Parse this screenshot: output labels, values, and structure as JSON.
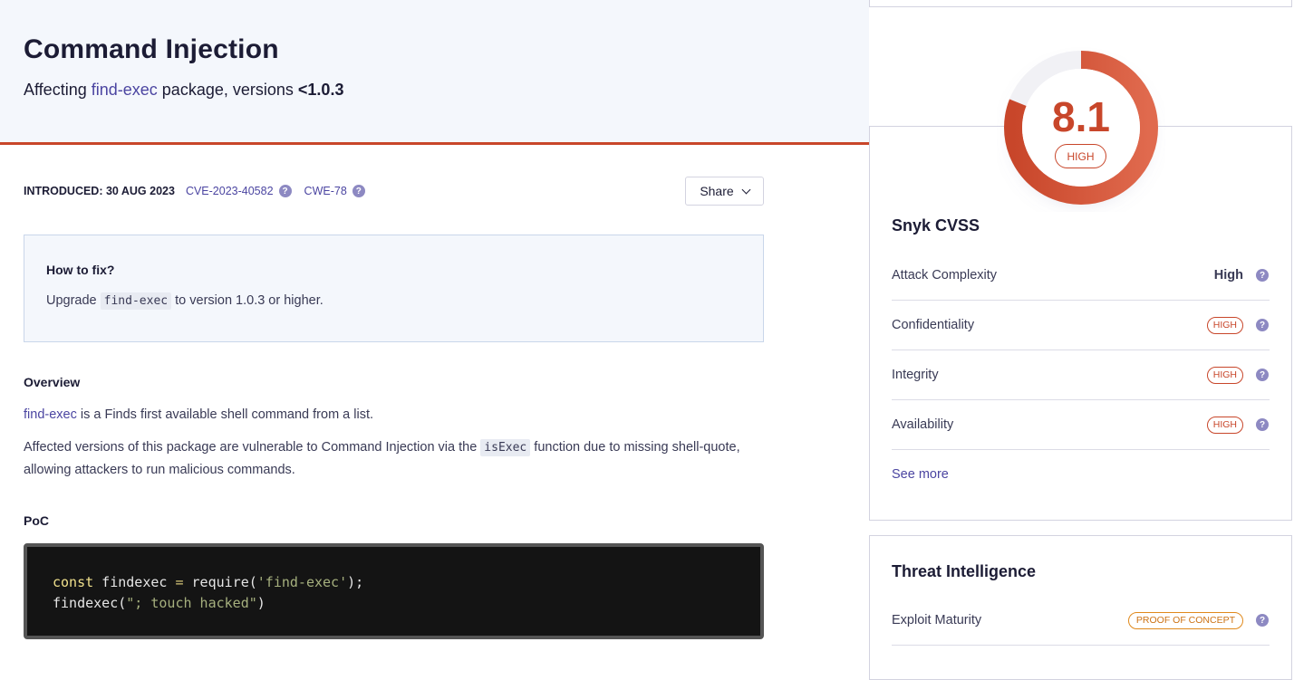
{
  "title": "Command Injection",
  "affect": {
    "prefix": "Affecting",
    "package": "find-exec",
    "middle": "package, versions",
    "versions": "<1.0.3"
  },
  "meta": {
    "introduced": "INTRODUCED: 30 AUG 2023",
    "cve": "CVE-2023-40582",
    "cwe": "CWE-78"
  },
  "share_label": "Share",
  "fix": {
    "heading": "How to fix?",
    "pre": "Upgrade",
    "code": "find-exec",
    "post": "to version 1.0.3 or higher."
  },
  "overview": {
    "heading": "Overview",
    "p1_link": "find-exec",
    "p1_rest": " is a Finds first available shell command from a list.",
    "p2_pre": "Affected versions of this package are vulnerable to Command Injection via the ",
    "p2_code": "isExec",
    "p2_post": " function due to missing shell-quote, allowing attackers to run malicious commands."
  },
  "poc": {
    "heading": "PoC",
    "line1": {
      "kw": "const",
      "name": " findexec ",
      "op": "=",
      "call": " require(",
      "str": "'find-exec'",
      "end": ");"
    },
    "line2": {
      "call": "findexec(",
      "str": "\"; touch hacked\"",
      "end": ")"
    }
  },
  "cvss": {
    "score": "8.1",
    "severity": "HIGH",
    "title": "Snyk CVSS",
    "rows": [
      {
        "label": "Attack Complexity",
        "value": "High"
      },
      {
        "label": "Confidentiality",
        "value": "HIGH"
      },
      {
        "label": "Integrity",
        "value": "HIGH"
      },
      {
        "label": "Availability",
        "value": "HIGH"
      }
    ],
    "see_more": "See more"
  },
  "threat": {
    "title": "Threat Intelligence",
    "rows": [
      {
        "label": "Exploit Maturity",
        "value": "PROOF OF CONCEPT"
      }
    ]
  },
  "colors": {
    "accent": "#c8462a",
    "link": "#4b45a1",
    "warning": "#e0891c"
  },
  "icons": {
    "help": "question-circle-icon",
    "chevron": "chevron-down-icon"
  }
}
